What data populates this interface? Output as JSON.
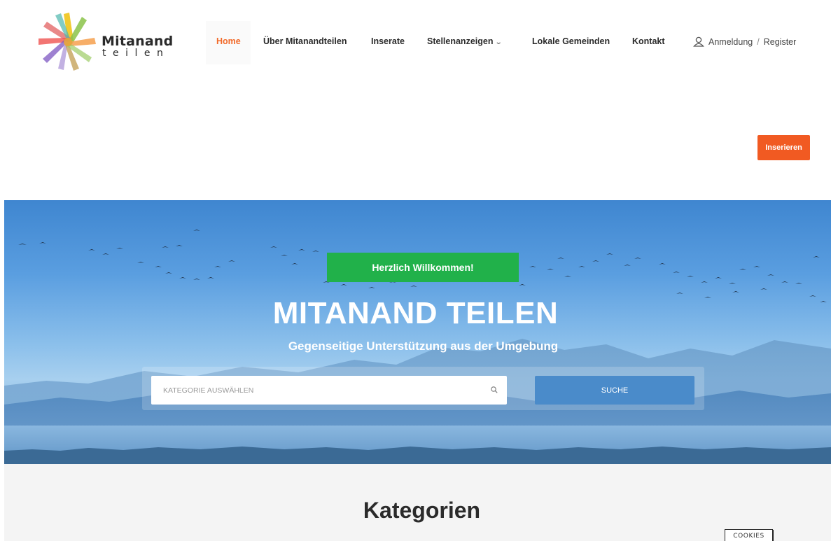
{
  "brand": {
    "logo_line1": "Mitanand",
    "logo_line2": "teilen"
  },
  "nav": {
    "home": "Home",
    "about": "Über Mitanandteilen",
    "ads": "Inserate",
    "jobs": "Stellenanzeigen",
    "communities": "Lokale Gemeinden",
    "contact": "Kontakt",
    "accent_color": "#f26a2a"
  },
  "auth": {
    "login": "Anmeldung",
    "separator": "/",
    "register": "Register"
  },
  "cta": {
    "insert_label": "Inserieren",
    "color": "#f15a22"
  },
  "hero": {
    "welcome": "Herzlich Willkommen!",
    "welcome_color": "#21b14a",
    "title": "MITANAND TEILEN",
    "subtitle": "Gegenseitige Unterstützung aus der Umgebung"
  },
  "search": {
    "placeholder": "KATEGORIE AUSWÄHLEN",
    "button": "SUCHE",
    "icon": "search-icon"
  },
  "categories": {
    "title": "Kategorien"
  },
  "cookies": {
    "label": "COOKIES"
  }
}
